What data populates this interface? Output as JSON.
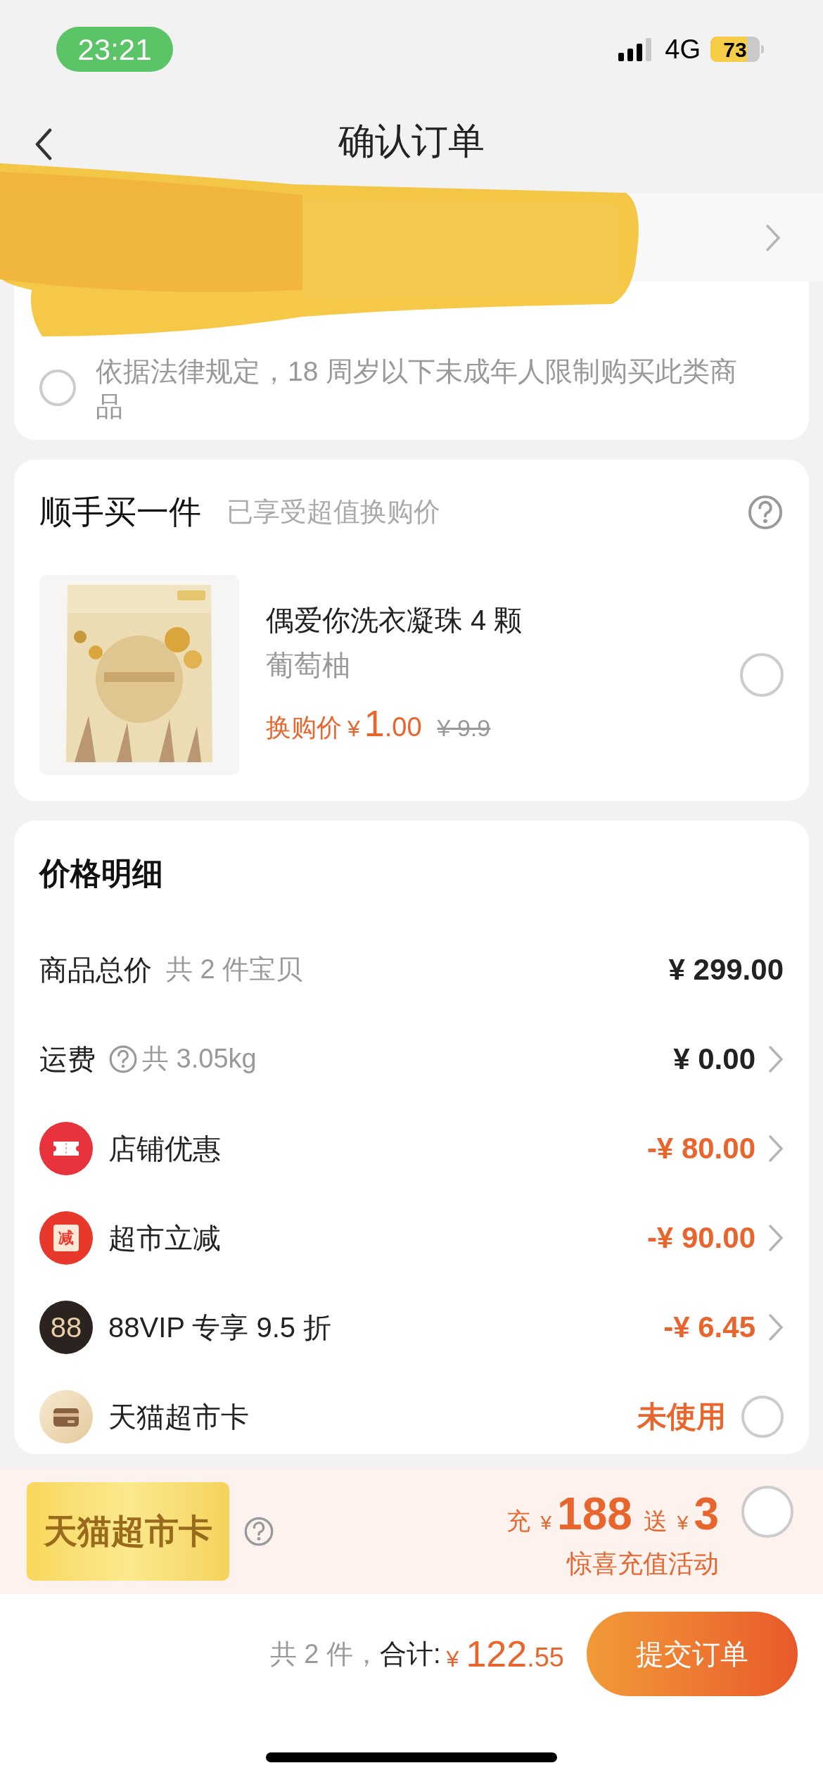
{
  "status_bar": {
    "time": "23:21",
    "network": "4G",
    "battery": "73"
  },
  "header": {
    "title": "确认订单"
  },
  "age_notice": {
    "text": "依据法律规定，18 周岁以下未成年人限制购买此类商品",
    "checked": false
  },
  "add_on": {
    "title": "顺手买一件",
    "subtitle": "已享受超值换购价",
    "item": {
      "name": "偶爱你洗衣凝珠 4 颗",
      "variant": "葡萄柚",
      "price_label": "换购价",
      "currency": "¥",
      "price_int": "1",
      "price_dec": ".00",
      "original_price": "¥ 9.9",
      "selected": false
    }
  },
  "price_details": {
    "title": "价格明细",
    "rows": [
      {
        "kind": "plain",
        "label": "商品总价",
        "note": "共 2 件宝贝",
        "help": false,
        "value": "¥ 299.00",
        "highlight": false,
        "chevron": false
      },
      {
        "kind": "plain",
        "label": "运费",
        "note": "共 3.05kg",
        "help": true,
        "value": "¥ 0.00",
        "highlight": false,
        "chevron": true
      },
      {
        "kind": "ticket",
        "label": "店铺优惠",
        "value": "-¥ 80.00",
        "highlight": true,
        "chevron": true
      },
      {
        "kind": "reduce",
        "badge": "减",
        "label": "超市立减",
        "value": "-¥ 90.00",
        "highlight": true,
        "chevron": true
      },
      {
        "kind": "vip",
        "badge": "88",
        "label": "88VIP 专享 9.5 折",
        "value": "-¥ 6.45",
        "highlight": true,
        "chevron": true
      },
      {
        "kind": "card",
        "label": "天猫超市卡",
        "value": "未使用",
        "highlight": true,
        "checked": false
      }
    ]
  },
  "promo": {
    "card_label": "天猫超市卡",
    "recharge_label": "充",
    "currency_1": "¥",
    "recharge_amount": "188",
    "bonus_label": "送",
    "currency_2": "¥",
    "bonus_amount": "3",
    "caption": "惊喜充值活动",
    "selected": false
  },
  "footer": {
    "count": "共 2 件，",
    "total_label": "合计:",
    "currency": "¥",
    "total_int": "122",
    "total_dec": ".55",
    "submit": "提交订单"
  }
}
